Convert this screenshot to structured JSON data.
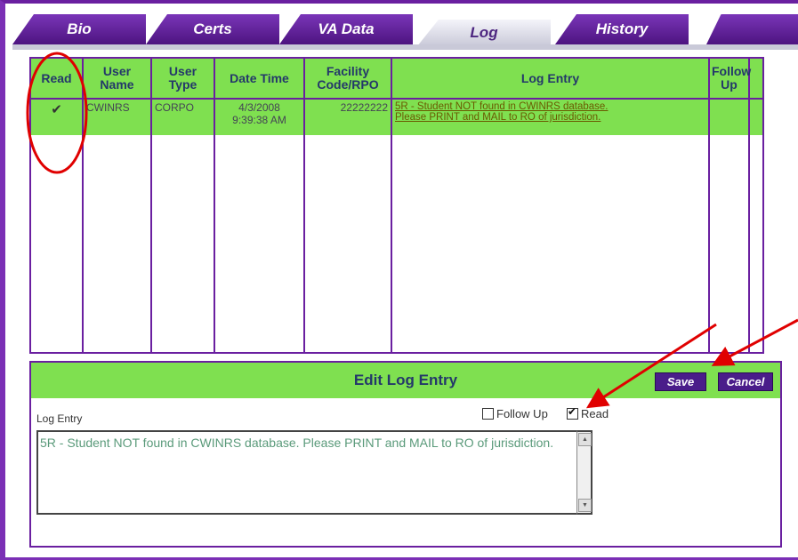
{
  "tabs": [
    {
      "label": "Bio"
    },
    {
      "label": "Certs"
    },
    {
      "label": "VA Data"
    },
    {
      "label": "Log"
    },
    {
      "label": "History"
    }
  ],
  "active_tab": "Log",
  "grid": {
    "headers": [
      "Read",
      "User Name",
      "User Type",
      "Date Time",
      "Facility Code/RPO",
      "Log Entry",
      "Follow Up"
    ],
    "rows": [
      {
        "read": "✔",
        "user_name": "CWINRS",
        "user_type": "CORPO",
        "date": "4/3/2008",
        "time": "9:39:38 AM",
        "facility": "22222222",
        "log_line1": "5R - Student NOT found in CWINRS database.",
        "log_line2": "Please PRINT and MAIL to RO of jurisdiction.",
        "follow_up": ""
      }
    ]
  },
  "edit": {
    "title": "Edit Log Entry",
    "save_label": "Save",
    "cancel_label": "Cancel",
    "log_entry_label": "Log Entry",
    "follow_up_label": "Follow Up",
    "follow_up_checked": false,
    "read_label": "Read",
    "read_checked": true,
    "log_entry_value": "5R - Student NOT found in CWINRS database. Please PRINT and MAIL to RO of jurisdiction."
  },
  "colors": {
    "accent": "#7b2fb5",
    "header_green": "#7fe050",
    "annotation_red": "#e00000"
  }
}
